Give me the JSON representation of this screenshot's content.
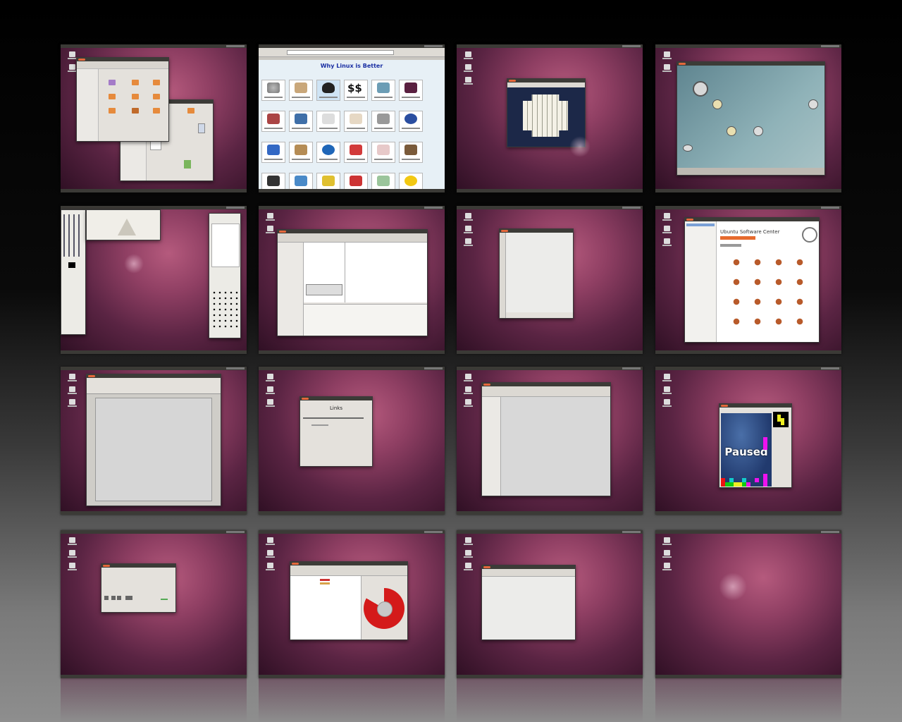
{
  "workspaces": [
    {
      "id": 1,
      "app": "file-manager"
    },
    {
      "id": 2,
      "app": "web-browser",
      "page_title": "Why Linux is Better",
      "price_tag": "$$"
    },
    {
      "id": 3,
      "app": "mahjongg"
    },
    {
      "id": 4,
      "app": "photo-app"
    },
    {
      "id": 5,
      "app": "gimp"
    },
    {
      "id": 6,
      "app": "mail-client"
    },
    {
      "id": 7,
      "app": "image-viewer"
    },
    {
      "id": 8,
      "app": "software-center",
      "title": "Ubuntu Software Center"
    },
    {
      "id": 9,
      "app": "word-processor"
    },
    {
      "id": 10,
      "app": "dialog",
      "heading": "Links"
    },
    {
      "id": 11,
      "app": "list-app"
    },
    {
      "id": 12,
      "app": "tetris",
      "status_text": "Paused"
    },
    {
      "id": 13,
      "app": "small-window"
    },
    {
      "id": 14,
      "app": "disk-usage-analyzer"
    },
    {
      "id": 15,
      "app": "empty-window"
    },
    {
      "id": 16,
      "app": "empty-desktop"
    }
  ],
  "colors": {
    "wallpaper": "#8f3f63",
    "panel": "#3b3a36",
    "window_bg": "#e4e1dc",
    "titlebar": "#3c3b37",
    "ubuntu_orange": "#e5683c",
    "selection": "#d65a2a"
  }
}
